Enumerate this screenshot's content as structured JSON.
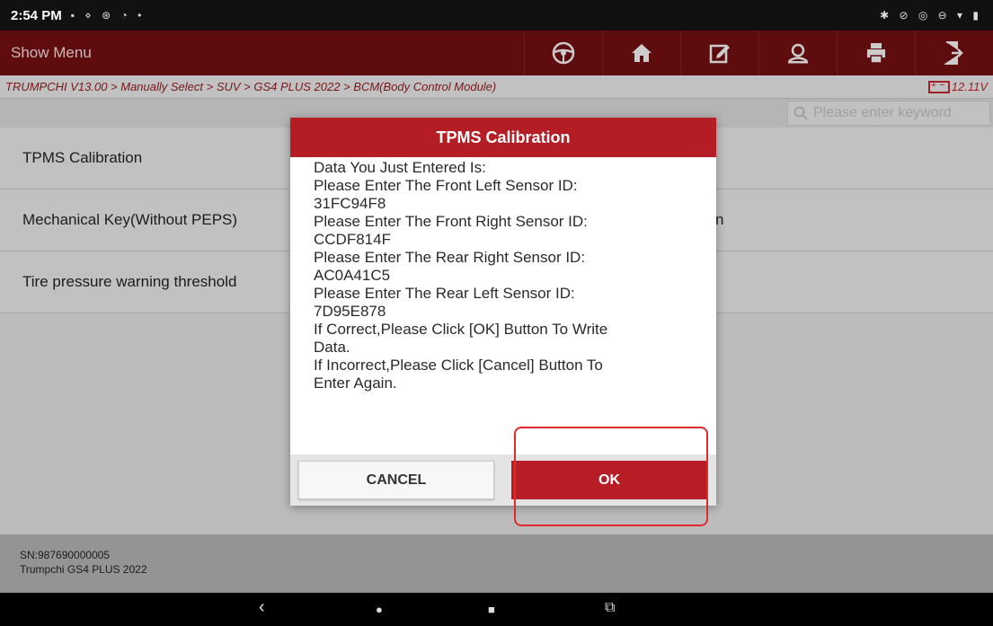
{
  "status_bar": {
    "time": "2:54 PM",
    "left_icons": "▪ ⋄ ⊛ ◔ •",
    "right_icons": "✱ ⊘ ◎ ⊖ ▾ ▮"
  },
  "menu": {
    "label": "Show Menu",
    "tools": [
      "steering-wheel-icon",
      "home-icon",
      "edit-icon",
      "user-support-icon",
      "print-icon",
      "exit-icon"
    ]
  },
  "breadcrumb": "TRUMPCHI V13.00 > Manually Select > SUV > GS4 PLUS 2022 > BCM(Body Control Module)",
  "battery": "12.11V",
  "search": {
    "placeholder": "Please enter keyword"
  },
  "list": [
    {
      "left": "TPMS Calibration",
      "right": ""
    },
    {
      "left": "Mechanical Key(Without PEPS)",
      "right": "n"
    },
    {
      "left": "Tire pressure warning threshold",
      "right": ""
    }
  ],
  "footer": {
    "sn": "SN:987690000005",
    "vehicle": "Trumpchi GS4 PLUS 2022"
  },
  "dialog": {
    "title": "TPMS Calibration",
    "lines": [
      "Data You Just Entered Is:",
      "Please Enter The Front Left Sensor ID:",
      "31FC94F8",
      "Please Enter The Front Right Sensor ID:",
      "CCDF814F",
      "Please Enter The Rear Right Sensor ID:",
      "AC0A41C5",
      "Please Enter The Rear Left Sensor ID:",
      "7D95E878",
      "If Correct,Please Click [OK] Button To Write",
      "Data.",
      "If Incorrect,Please Click [Cancel] Button To",
      "Enter Again."
    ],
    "cancel_label": "CANCEL",
    "ok_label": "OK"
  },
  "nav": {
    "back": "‹",
    "home": "●",
    "recents": "■",
    "screenshot": "⧉"
  },
  "colors": {
    "brand": "#6d0e12",
    "accent": "#b41d24",
    "highlight": "#e12b2b"
  }
}
